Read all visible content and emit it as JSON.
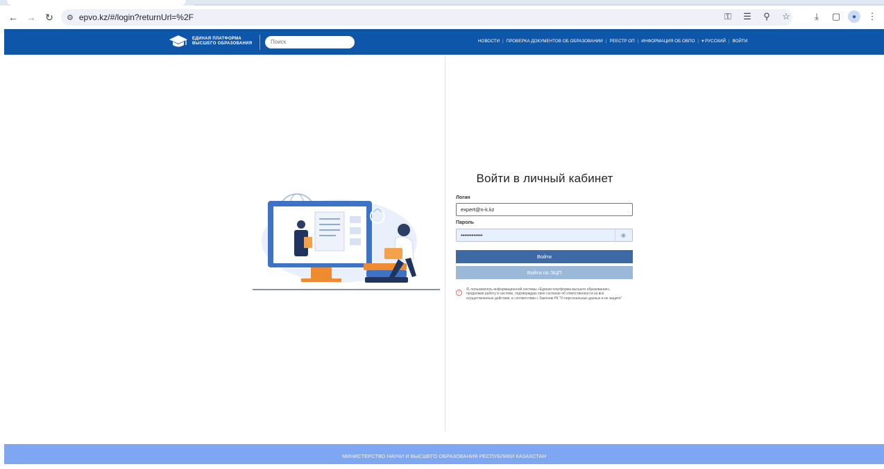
{
  "browser": {
    "url": "epvo.kz/#/login?returnUrl=%2F",
    "icons": [
      "back-icon",
      "forward-icon",
      "reload-icon",
      "tune-icon",
      "password-key-icon",
      "translate-icon",
      "zoom-icon",
      "star-icon",
      "download-icon",
      "sidepanel-icon",
      "profile-icon",
      "menu-icon"
    ]
  },
  "header": {
    "logo_line1": "ЕДИНАЯ ПЛАТФОРМА",
    "logo_line2": "ВЫСШЕГО ОБРАЗОВАНИЯ",
    "search_placeholder": "Поиск",
    "nav": {
      "news": "НОВОСТИ",
      "docs_check": "ПРОВЕРКА ДОКУМЕНТОВ ОБ ОБРАЗОВАНИИ",
      "registry": "РЕЕСТР ОП",
      "info": "ИНФОРМАЦИЯ ОБ ОВПО",
      "language": "РУССКИЙ",
      "login": "ВОЙТИ"
    },
    "color": "#0e56a9"
  },
  "login": {
    "title": "Войти в личный кабинет",
    "login_label": "Логин",
    "login_value": "expert@n-k.kz",
    "password_label": "Пароль",
    "password_value": "••••••••••••",
    "submit_label": "Войти",
    "eds_label": "Войти по ЭЦП",
    "notice": "Я, пользователь информационной системы «Единая платформа высшего образования», продолжая работу в системе, подтверждаю свое согласие об ответственности за все осуществленные действия, в соответствии с Законом РК \"О персональных данных и их защите\""
  },
  "footer": {
    "text": "МИНИСТЕРСТВО НАУКИ И ВЫСШЕГО ОБРАЗОВАНИЯ РЕСПУБЛИКИ КАЗАХСТАН",
    "color": "#7fa6f0"
  }
}
